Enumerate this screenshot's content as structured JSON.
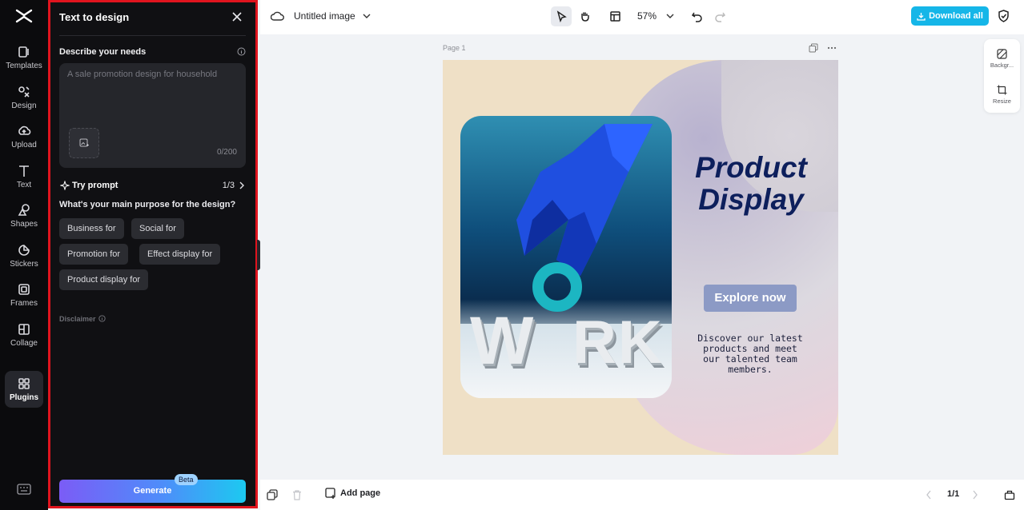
{
  "rail": {
    "items": [
      {
        "label": "Templates",
        "icon": "templates-icon"
      },
      {
        "label": "Design",
        "icon": "design-icon"
      },
      {
        "label": "Upload",
        "icon": "upload-icon"
      },
      {
        "label": "Text",
        "icon": "text-icon"
      },
      {
        "label": "Shapes",
        "icon": "shapes-icon"
      },
      {
        "label": "Stickers",
        "icon": "stickers-icon"
      },
      {
        "label": "Frames",
        "icon": "frames-icon"
      },
      {
        "label": "Collage",
        "icon": "collage-icon"
      },
      {
        "label": "Plugins",
        "icon": "plugins-icon"
      }
    ],
    "active": "Plugins"
  },
  "panel": {
    "title": "Text to design",
    "describe_label": "Describe your needs",
    "prompt_placeholder": "A sale promotion design for household",
    "counter": "0/200",
    "try_prompt": "Try prompt",
    "prompt_page": "1/3",
    "question": "What's your main purpose for the design?",
    "chips": [
      "Business for",
      "Social for",
      "Promotion for",
      "Effect display for",
      "Product display for"
    ],
    "disclaimer": "Disclaimer",
    "generate": "Generate",
    "beta": "Beta"
  },
  "topbar": {
    "doc_title": "Untitled image",
    "zoom": "57%",
    "download": "Download all"
  },
  "side_tools": [
    {
      "label": "Backgr...",
      "icon": "background-icon"
    },
    {
      "label": "Resize",
      "icon": "resize-icon"
    }
  ],
  "canvas": {
    "page_label": "Page 1",
    "headline_line1": "Product",
    "headline_line2": "Display",
    "cta": "Explore now",
    "body_text": "Discover our latest products and meet our talented team members.",
    "photo_letters_left": "W",
    "photo_letters_right": "RK"
  },
  "bottombar": {
    "add_page": "Add page",
    "pager": "1/1"
  },
  "colors": {
    "accent": "#15b6e8",
    "panel_border": "#e0141e",
    "headline": "#0d1f5c",
    "canvas_bg": "#efe0c6"
  }
}
